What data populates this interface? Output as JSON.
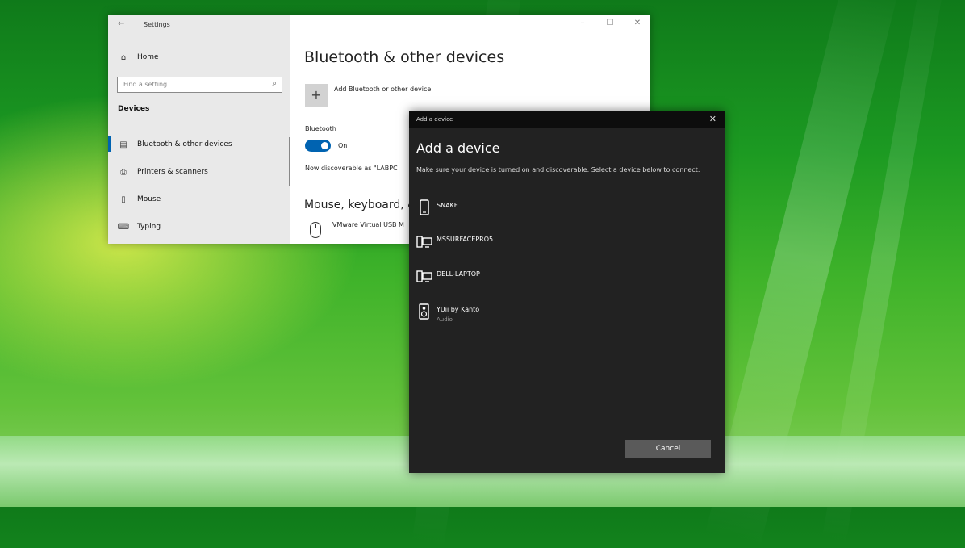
{
  "settings": {
    "window_title": "Settings",
    "search_placeholder": "Find a setting",
    "section": "Devices",
    "nav": [
      {
        "label": "Home"
      },
      {
        "label": "Bluetooth & other devices"
      },
      {
        "label": "Printers & scanners"
      },
      {
        "label": "Mouse"
      },
      {
        "label": "Typing"
      }
    ],
    "main": {
      "title": "Bluetooth & other devices",
      "add_button_label": "Add Bluetooth or other device",
      "bluetooth_label": "Bluetooth",
      "bluetooth_state": "On",
      "discoverable_text": "Now discoverable as \"LABPC",
      "mouse_heading": "Mouse, keyboard, &",
      "vm_device": "VMware Virtual USB M"
    }
  },
  "dialog": {
    "window_title": "Add a device",
    "heading": "Add a device",
    "description": "Make sure your device is turned on and discoverable. Select a device below to connect.",
    "devices": [
      {
        "name": "SNAKE",
        "subtitle": "",
        "icon": "phone-icon"
      },
      {
        "name": "MSSURFACEPRO5",
        "subtitle": "",
        "icon": "computer-icon"
      },
      {
        "name": "DELL-LAPTOP",
        "subtitle": "",
        "icon": "computer-icon"
      },
      {
        "name": "YUii by Kanto",
        "subtitle": "Audio",
        "icon": "speaker-icon"
      }
    ],
    "cancel_label": "Cancel"
  },
  "colors": {
    "accent": "#0063b1",
    "dialog_bg": "#222222",
    "dialog_titlebar": "#0d0d0d",
    "cancel_bg": "#5a5a5a"
  }
}
